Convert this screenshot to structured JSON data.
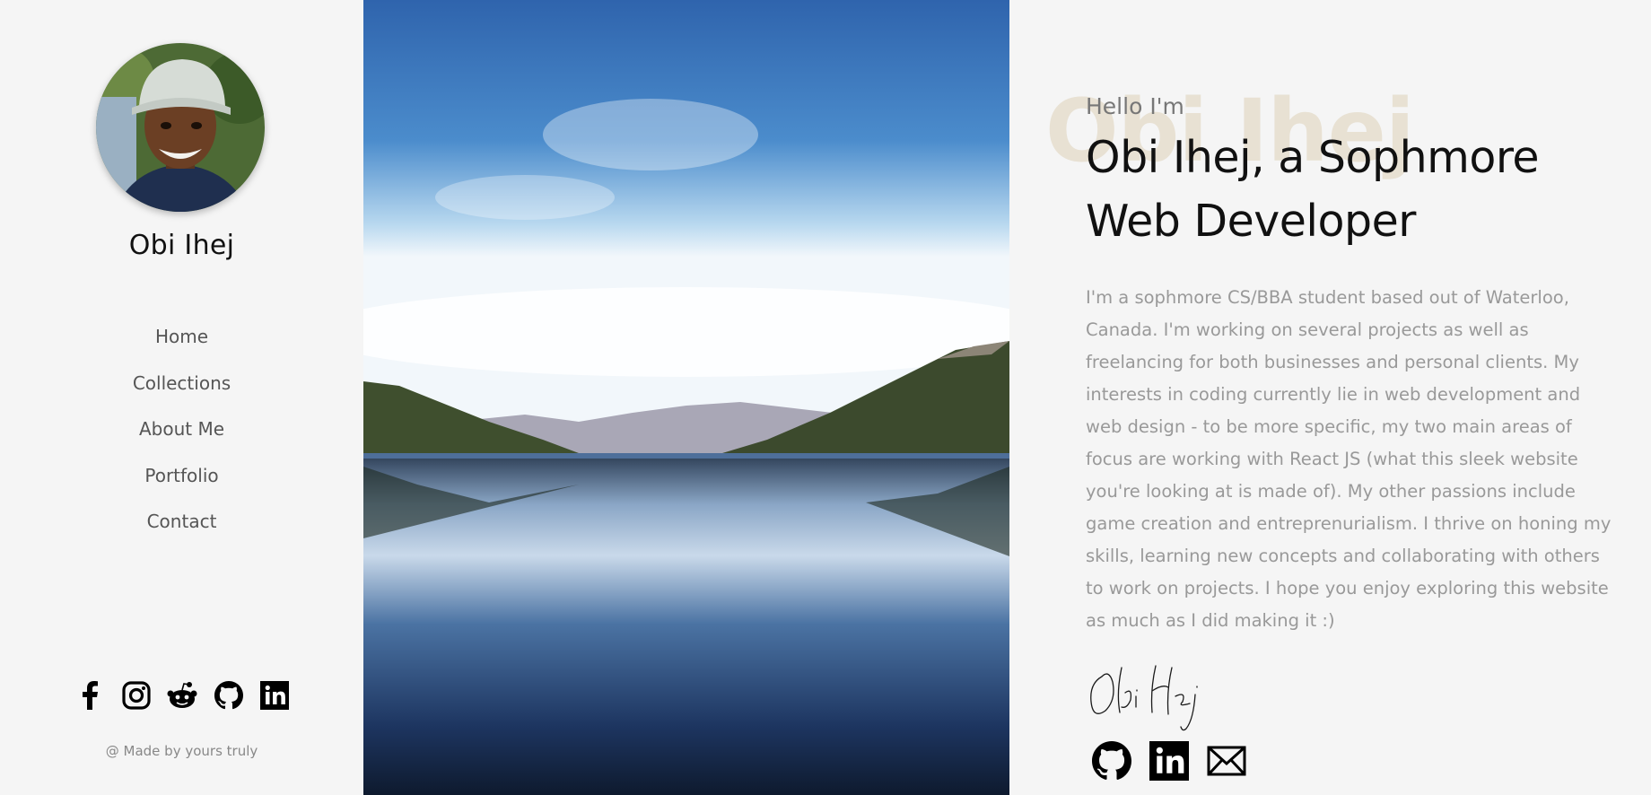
{
  "sidebar": {
    "name": "Obi Ihej",
    "nav": [
      {
        "label": "Home"
      },
      {
        "label": "Collections"
      },
      {
        "label": "About Me"
      },
      {
        "label": "Portfolio"
      },
      {
        "label": "Contact"
      }
    ],
    "socials": [
      "facebook-icon",
      "instagram-icon",
      "reddit-icon",
      "github-icon",
      "linkedin-icon"
    ],
    "footer": "@ Made by yours truly"
  },
  "main": {
    "bg_name": "Obi Ihej",
    "greeting": "Hello I'm",
    "headline": "Obi Ihej, a Sophmore Web Developer",
    "bio": "I'm a sophmore CS/BBA student based out of Waterloo, Canada. I'm working on several projects as well as freelancing for both businesses and personal clients. My interests in coding currently lie in web development and web design - to be more specific, my two main areas of focus are working with React JS (what this sleek website you're looking at is made of). My other passions include game creation and entreprenurialism. I thrive on honing my skills, learning new concepts and collaborating with others to work on projects. I hope you enjoy exploring this website as much as I did making it :)",
    "signature": "Obi Ihej",
    "contact_icons": [
      "github-icon",
      "linkedin-icon",
      "mail-icon"
    ]
  },
  "colors": {
    "background": "#f5f5f5",
    "heading": "#111111",
    "body_text": "#999999",
    "bg_name": "#e8e1d3",
    "nav_text": "#555555"
  }
}
